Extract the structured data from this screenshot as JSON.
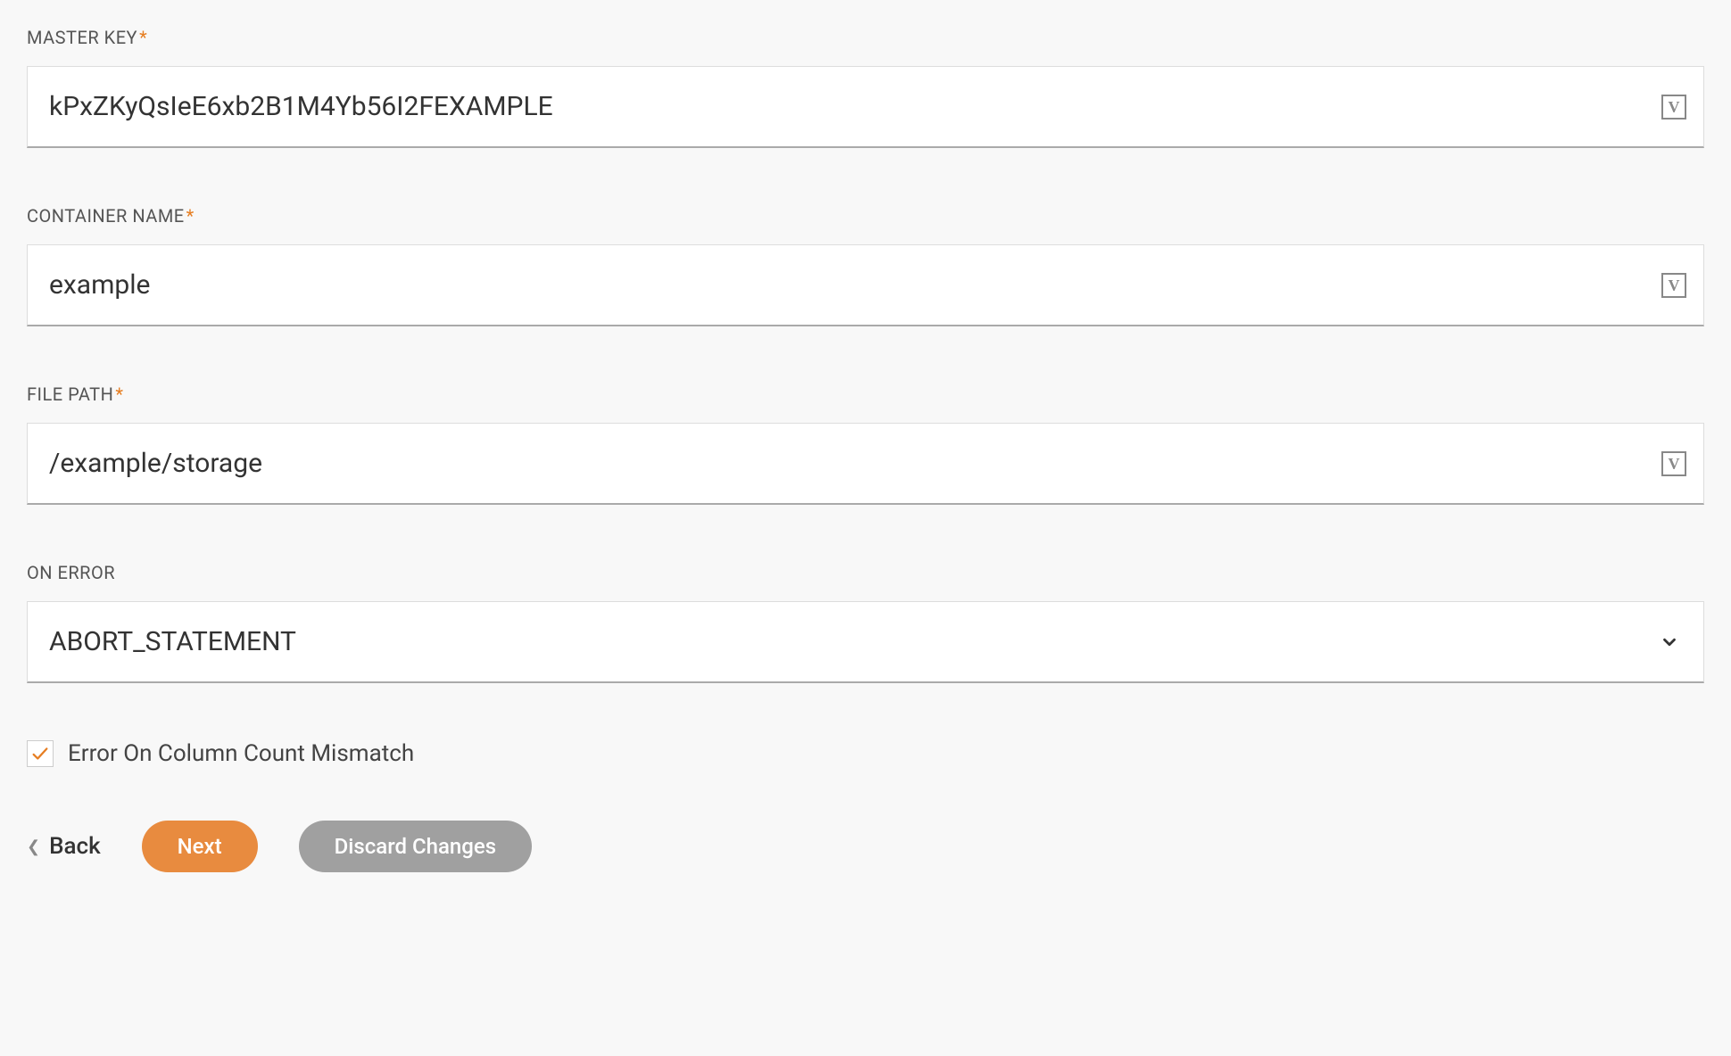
{
  "fields": {
    "master_key": {
      "label": "MASTER KEY",
      "required": "*",
      "value": "kPxZKyQsIeE6xb2B1M4Yb56I2FEXAMPLE",
      "icon_letter": "V"
    },
    "container_name": {
      "label": "CONTAINER NAME",
      "required": "*",
      "value": "example",
      "icon_letter": "V"
    },
    "file_path": {
      "label": "FILE PATH",
      "required": "*",
      "value": "/example/storage",
      "icon_letter": "V"
    },
    "on_error": {
      "label": "ON ERROR",
      "value": "ABORT_STATEMENT"
    }
  },
  "checkbox": {
    "label": "Error On Column Count Mismatch",
    "checked": true
  },
  "buttons": {
    "back": "Back",
    "next": "Next",
    "discard": "Discard Changes"
  }
}
